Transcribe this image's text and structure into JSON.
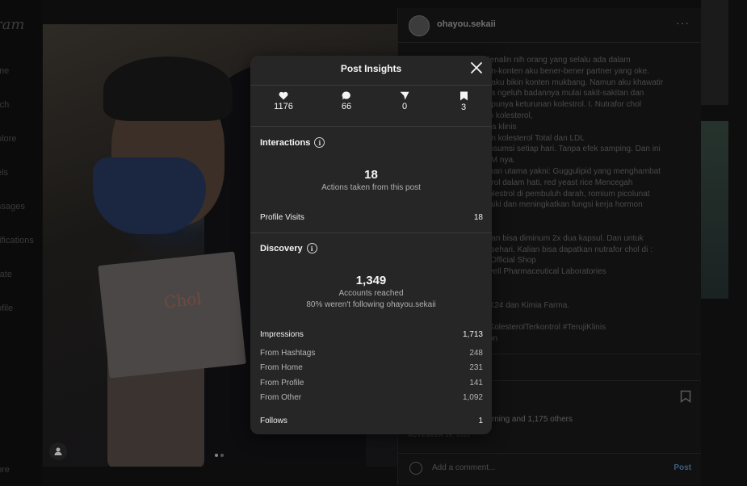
{
  "background": {
    "logo": "ram",
    "nav": [
      "me",
      "rch",
      "olore",
      "els",
      "ssages",
      "tifications",
      "rate",
      "ofile",
      "ore"
    ],
    "username": "ohayou.sekaii",
    "more": "···",
    "caption_lines": [
      "Kenalin nih orang yang selalu ada dalam",
      "ten-konten aku bener-bener partner yang oke.",
      "u aku bikin konten mukbang. Namun aku khawatir",
      "dia ngeluh badannya mulai sakit-sakitan dan",
      "a punya keturunan kolestrol. I. Nutrafor chol",
      "en kolesterol,",
      "ara klinis",
      "tan kolesterol Total dan LDL",
      "onsumsi setiap hari. Tanpa efek samping. Dan ini",
      "OM nya.",
      "ahan utama yakni: Guggulipid yang menghambat",
      "terol dalam hati, red yeast rice Mencegah",
      "kolestrol di pembuluh darah, romium picolunat",
      "baiki dan meningkatkan fungsi kerja hormon",
      "",
      "",
      "atan bisa diminum 2x dua kapsul. Dan untuk",
      "x sehari. Kalian bisa dapatkan nutrafor chol di :",
      "ll Official Shop",
      "ovell Pharmaceutical Laboratories",
      "",
      "",
      ": K24 dan Kimia Farma.",
      "",
      "#KolesterolTerkontrol #TerujiKlinis",
      "tion"
    ],
    "likes": "morning and 1,175 others",
    "date": "NOVEMBER 18, 2022",
    "comment_placeholder": "Add a comment...",
    "post_label": "Post"
  },
  "modal": {
    "title": "Post Insights",
    "stats": [
      {
        "icon": "heart-icon",
        "value": "1176"
      },
      {
        "icon": "comment-icon",
        "value": "66"
      },
      {
        "icon": "share-icon",
        "value": "0"
      },
      {
        "icon": "bookmark-icon",
        "value": "3"
      }
    ],
    "interactions": {
      "title": "Interactions",
      "count": "18",
      "caption": "Actions taken from this post",
      "profile_visits_label": "Profile Visits",
      "profile_visits_value": "18"
    },
    "discovery": {
      "title": "Discovery",
      "count": "1,349",
      "caption": "Accounts reached",
      "following_note": "80% weren't following ohayou.sekaii",
      "impressions_label": "Impressions",
      "impressions_value": "1,713",
      "sources": [
        {
          "label": "From Hashtags",
          "value": "248"
        },
        {
          "label": "From Home",
          "value": "231"
        },
        {
          "label": "From Profile",
          "value": "141"
        },
        {
          "label": "From Other",
          "value": "1,092"
        }
      ],
      "follows_label": "Follows",
      "follows_value": "1"
    }
  }
}
